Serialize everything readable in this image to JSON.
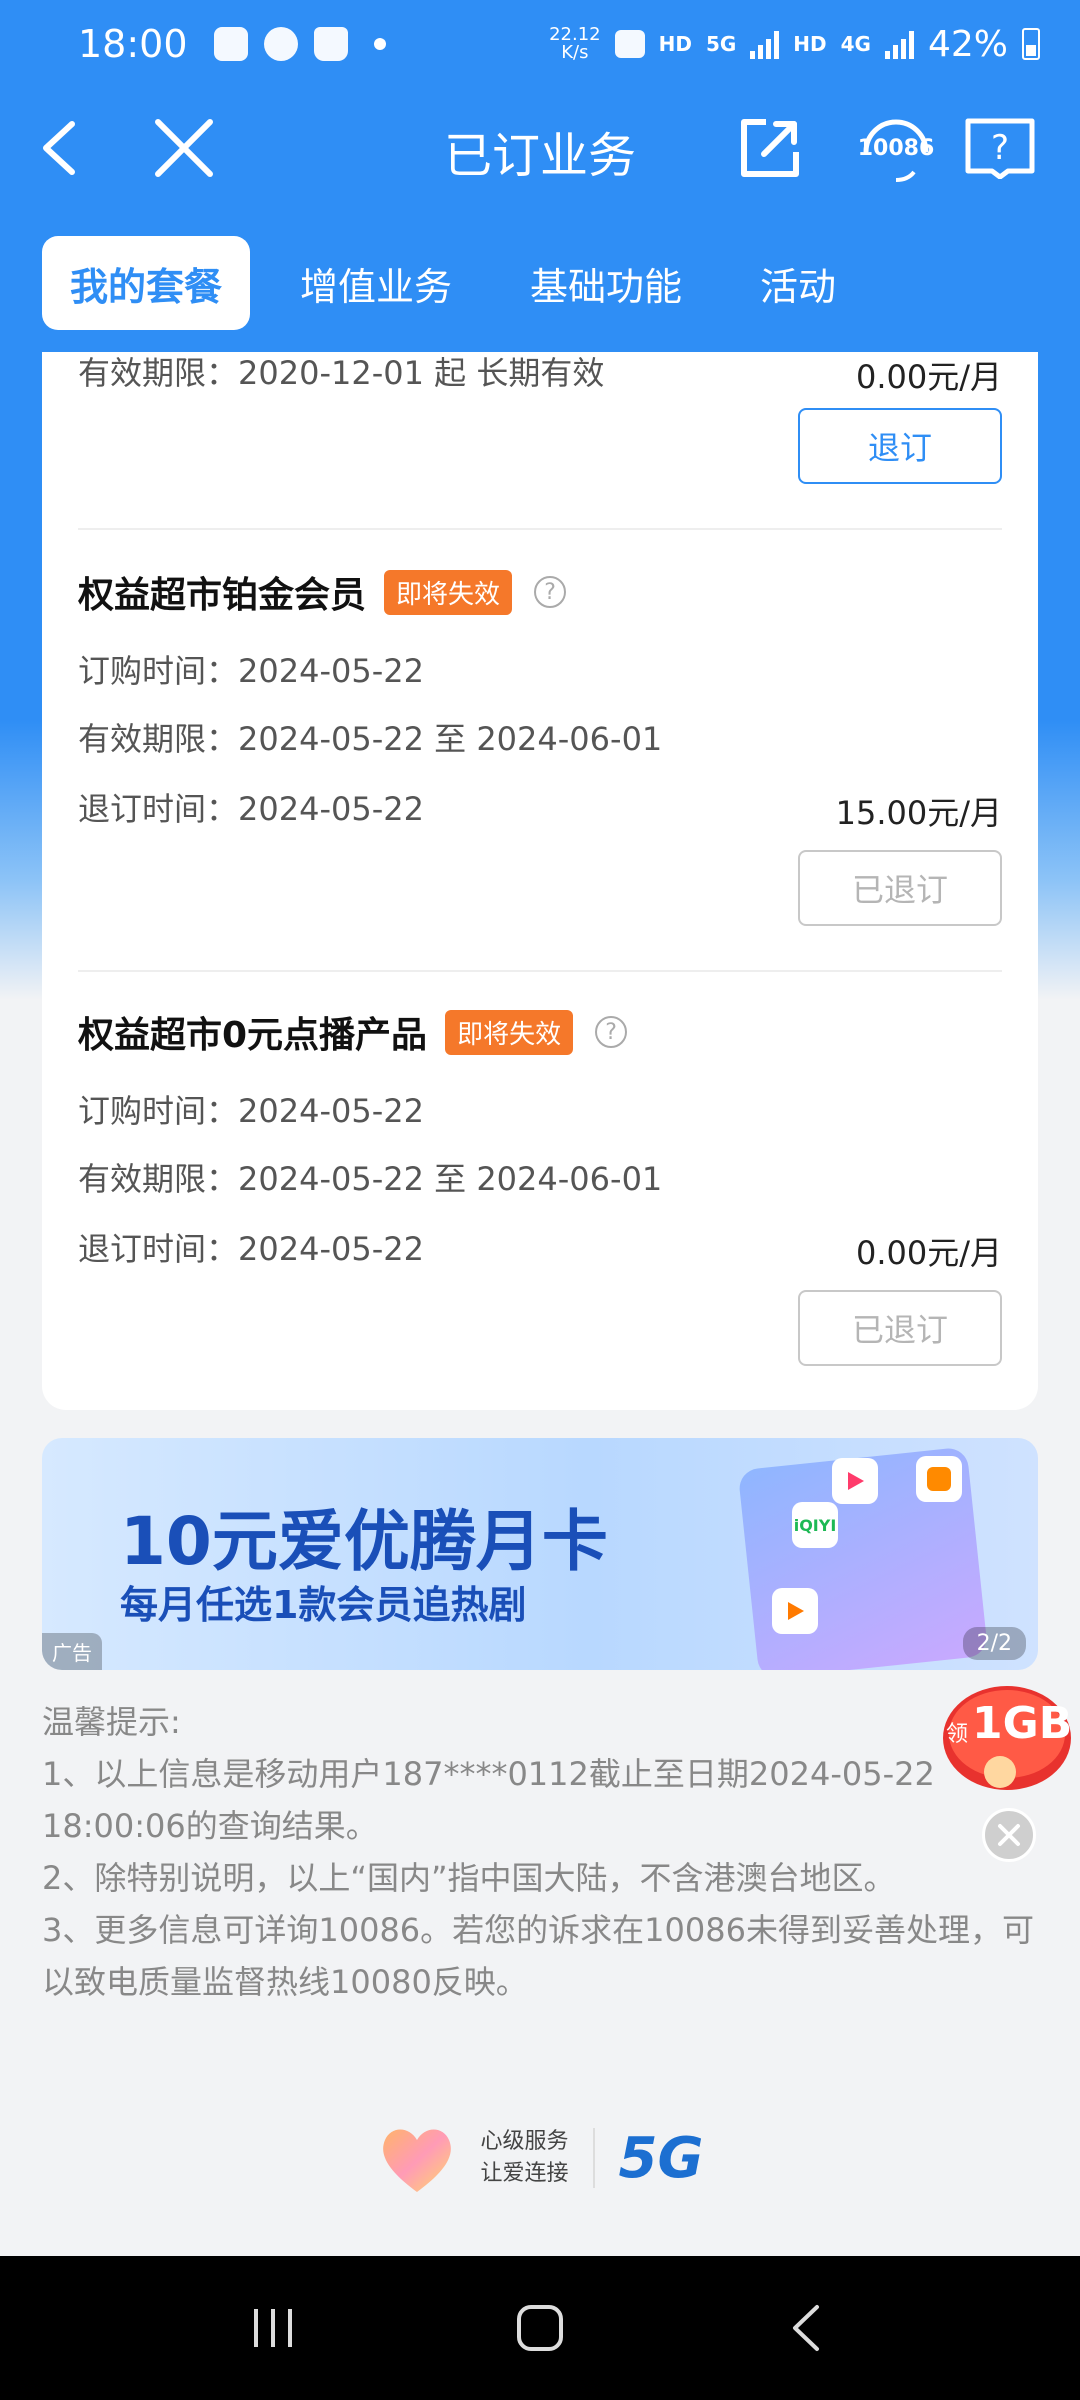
{
  "status_bar": {
    "time": "18:00",
    "net_speed_value": "22.12",
    "net_speed_unit": "K/s",
    "hd1": "HD",
    "net_5g": "5G",
    "hd2": "HD",
    "net_4g": "4G",
    "battery": "42%"
  },
  "header": {
    "title": "已订业务",
    "service_badge": "10086"
  },
  "tabs": [
    {
      "label": "我的套餐"
    },
    {
      "label": "增值业务"
    },
    {
      "label": "基础功能"
    },
    {
      "label": "活动"
    }
  ],
  "items": [
    {
      "validity": "有效期限：2020-12-01 起 长期有效",
      "price": "0.00元/月",
      "button": "退订"
    },
    {
      "title": "权益超市铂金会员",
      "tag": "即将失效",
      "order_time": "订购时间：2024-05-22",
      "validity": "有效期限：2024-05-22 至 2024-06-01",
      "cancel_time": "退订时间：2024-05-22",
      "price": "15.00元/月",
      "button": "已退订"
    },
    {
      "title": "权益超市0元点播产品",
      "tag": "即将失效",
      "order_time": "订购时间：2024-05-22",
      "validity": "有效期限：2024-05-22 至 2024-06-01",
      "cancel_time": "退订时间：2024-05-22",
      "price": "0.00元/月",
      "button": "已退订"
    }
  ],
  "banner": {
    "title": "10元爱优腾月卡",
    "subtitle": "每月任选1款会员追热剧",
    "ad_label": "广告",
    "page_indicator": "2/2",
    "app_iqiyi": "iQIYI"
  },
  "tips": {
    "heading": "温馨提示:",
    "line1": "1、以上信息是移动用户187****0112截止至日期2024-05-22 18:00:06的查询结果。",
    "line2": "2、除特别说明，以上“国内”指中国大陆，不含港澳台地区。",
    "line3": "3、更多信息可详询10086。若您的诉求在10086未得到妥善处理，可以致电质量监督热线10080反映。"
  },
  "float_promo": {
    "label": "领",
    "amount": "1GB"
  },
  "footer": {
    "slogan_1": "心级服务",
    "slogan_2": "让爱连接",
    "brand": "5G"
  },
  "colors": {
    "primary": "#2f8ef5",
    "tag": "#f5782a",
    "banner_text": "#1a4fb8"
  }
}
